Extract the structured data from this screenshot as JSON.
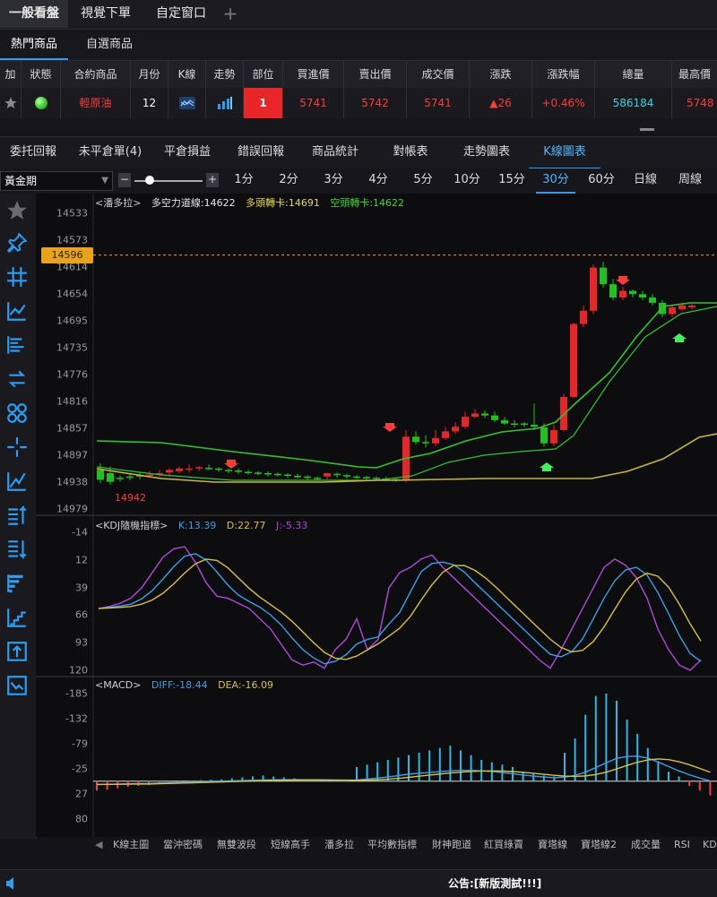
{
  "top_tabs": [
    {
      "label": "一般看盤",
      "active": true
    },
    {
      "label": "視覺下單",
      "active": false
    },
    {
      "label": "自定窗口",
      "active": false
    }
  ],
  "add_tab_symbol": "+",
  "product_tabs": [
    {
      "label": "熱門商品",
      "active": true
    },
    {
      "label": "自選商品",
      "active": false
    }
  ],
  "quote_headers": [
    "加",
    "狀態",
    "合約商品",
    "月份",
    "K線",
    "走勢",
    "部位",
    "買進價",
    "賣出價",
    "成交價",
    "漲跌",
    "漲跌幅",
    "總量",
    "最高價"
  ],
  "quote_row": {
    "add_icon": "star-icon",
    "status_color": "#36d63a",
    "product": "輕原油",
    "month": "12",
    "kline_icon": "kline-icon",
    "trend_icon": "trend-icon",
    "position": "1",
    "bid": "5741",
    "ask": "5742",
    "last": "5741",
    "change": "▲26",
    "change_pct": "+0.46%",
    "volume": "586184",
    "high": "5748"
  },
  "report_tabs": [
    {
      "label": "委托回報",
      "active": false
    },
    {
      "label": "未平倉單(4)",
      "active": false
    },
    {
      "label": "平倉損益",
      "active": false
    },
    {
      "label": "錯誤回報",
      "active": false
    },
    {
      "label": "商品統計",
      "active": false
    },
    {
      "label": "對帳表",
      "active": false
    },
    {
      "label": "走勢圖表",
      "active": false
    },
    {
      "label": "K線圖表",
      "active": true
    }
  ],
  "toolbar": {
    "product_select": "黃金期",
    "zoom_out": "−",
    "zoom_in": "+"
  },
  "periods": [
    {
      "label": "1分",
      "active": false
    },
    {
      "label": "2分",
      "active": false
    },
    {
      "label": "3分",
      "active": false
    },
    {
      "label": "4分",
      "active": false
    },
    {
      "label": "5分",
      "active": false
    },
    {
      "label": "10分",
      "active": false
    },
    {
      "label": "15分",
      "active": false
    },
    {
      "label": "30分",
      "active": true
    },
    {
      "label": "60分",
      "active": false
    },
    {
      "label": "日線",
      "active": false
    },
    {
      "label": "周線",
      "active": false
    }
  ],
  "tools": [
    "star-icon",
    "pin-icon",
    "grid-icon",
    "line-chart-icon",
    "bars-left-icon",
    "swap-icon",
    "link-icon",
    "crosshair-icon",
    "trend-icon",
    "sort-up-icon",
    "sort-down-icon",
    "hbar-icon",
    "step-icon",
    "upload-icon",
    "image-chart-icon"
  ],
  "main_chart": {
    "legend": [
      {
        "text": "<潘多拉>",
        "color": "#cfcfcf"
      },
      {
        "text": "多空力道線:14622",
        "color": "#e8e8e8"
      },
      {
        "text": "多頭轉卡:14691",
        "color": "#e6d84a"
      },
      {
        "text": "空頭轉卡:14622",
        "color": "#3ed63a"
      }
    ],
    "yticks": [
      "14533",
      "14573",
      "14614",
      "14654",
      "14695",
      "14735",
      "14776",
      "14816",
      "14857",
      "14897",
      "14938",
      "14979"
    ],
    "price_tag": "14596",
    "low_label": "14942"
  },
  "kdj_chart": {
    "legend": [
      {
        "text": "<KDJ隨機指標>",
        "color": "#cfcfcf"
      },
      {
        "text": "K:13.39",
        "color": "#3aa0e8"
      },
      {
        "text": "D:22.77",
        "color": "#d8c040"
      },
      {
        "text": "J:-5.33",
        "color": "#b04ad8"
      }
    ],
    "yticks": [
      "-14",
      "12",
      "39",
      "66",
      "93",
      "120"
    ]
  },
  "macd_chart": {
    "legend": [
      {
        "text": "<MACD>",
        "color": "#cfcfcf"
      },
      {
        "text": "DIFF:-18.44",
        "color": "#3aa0e8"
      },
      {
        "text": "DEA:-16.09",
        "color": "#d8c040"
      }
    ],
    "yticks": [
      "-185",
      "-132",
      "-79",
      "-25",
      "27",
      "80"
    ]
  },
  "indicator_tabs": [
    "K線主圖",
    "當沖密碼",
    "無雙波段",
    "短線高手",
    "潘多拉",
    "平均數指標",
    "財神跑道",
    "紅買綠賣",
    "寶塔線",
    "寶塔線2",
    "成交量",
    "RSI",
    "KD"
  ],
  "status": {
    "announcement": "公告:[新版測試!!!]"
  },
  "colors": {
    "up": "#e8262a",
    "down": "#1ec41e",
    "accent": "#2a9df4"
  },
  "chart_data": [
    {
      "type": "candlestick",
      "title": "<潘多拉>",
      "yticks": [
        14533,
        14573,
        14614,
        14654,
        14695,
        14735,
        14776,
        14816,
        14857,
        14897,
        14938,
        14979
      ],
      "series": [
        {
          "name": "多空力道線",
          "last": 14622
        },
        {
          "name": "多頭轉卡",
          "last": 14691
        },
        {
          "name": "空頭轉卡",
          "last": 14622
        }
      ],
      "price_line": 14596,
      "low_marker": 14942
    },
    {
      "type": "line",
      "title": "<KDJ隨機指標>",
      "yticks": [
        -14,
        12,
        39,
        66,
        93,
        120
      ],
      "series": [
        {
          "name": "K",
          "last": 13.39
        },
        {
          "name": "D",
          "last": 22.77
        },
        {
          "name": "J",
          "last": -5.33
        }
      ]
    },
    {
      "type": "bar",
      "title": "<MACD>",
      "yticks": [
        -185,
        -132,
        -79,
        -25,
        27,
        80
      ],
      "series": [
        {
          "name": "DIFF",
          "last": -18.44
        },
        {
          "name": "DEA",
          "last": -16.09
        }
      ]
    }
  ]
}
